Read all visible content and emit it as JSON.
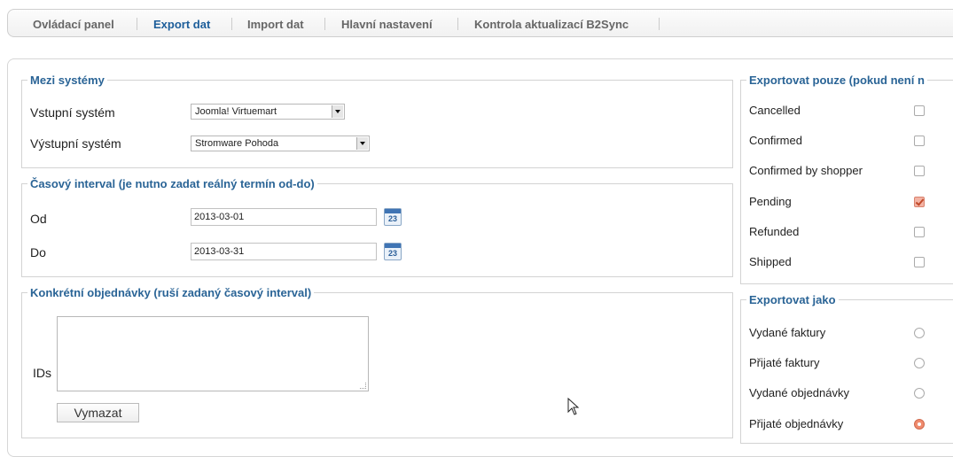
{
  "tabs": [
    {
      "label": "Ovládací panel",
      "active": false
    },
    {
      "label": "Export dat",
      "active": true
    },
    {
      "label": "Import dat",
      "active": false
    },
    {
      "label": "Hlavní nastavení",
      "active": false
    },
    {
      "label": "Kontrola aktualizací B2Sync",
      "active": false
    }
  ],
  "systems": {
    "legend": "Mezi systémy",
    "input_label": "Vstupní systém",
    "input_value": "Joomla! Virtuemart",
    "output_label": "Výstupní systém",
    "output_value": "Stromware Pohoda"
  },
  "interval": {
    "legend": "Časový interval (je nutno zadat reálný termín od-do)",
    "from_label": "Od",
    "from_value": "2013-03-01",
    "to_label": "Do",
    "to_value": "2013-03-31",
    "calendar_day": "23"
  },
  "orders": {
    "legend": "Konkrétní objednávky (ruší zadaný časový interval)",
    "ids_label": "IDs",
    "ids_value": "",
    "clear_button": "Vymazat"
  },
  "export_only": {
    "legend": "Exportovat pouze (pokud není n",
    "options": [
      {
        "label": "Cancelled",
        "checked": false
      },
      {
        "label": "Confirmed",
        "checked": false
      },
      {
        "label": "Confirmed by shopper",
        "checked": false
      },
      {
        "label": "Pending",
        "checked": true
      },
      {
        "label": "Refunded",
        "checked": false
      },
      {
        "label": "Shipped",
        "checked": false
      }
    ]
  },
  "export_as": {
    "legend": "Exportovat jako",
    "options": [
      {
        "label": "Vydané faktury",
        "selected": false
      },
      {
        "label": "Přijaté faktury",
        "selected": false
      },
      {
        "label": "Vydané objednávky",
        "selected": false
      },
      {
        "label": "Přijaté objednávky",
        "selected": true
      }
    ]
  },
  "colors": {
    "accent": "#2a6496",
    "checked": "#e8735a"
  }
}
